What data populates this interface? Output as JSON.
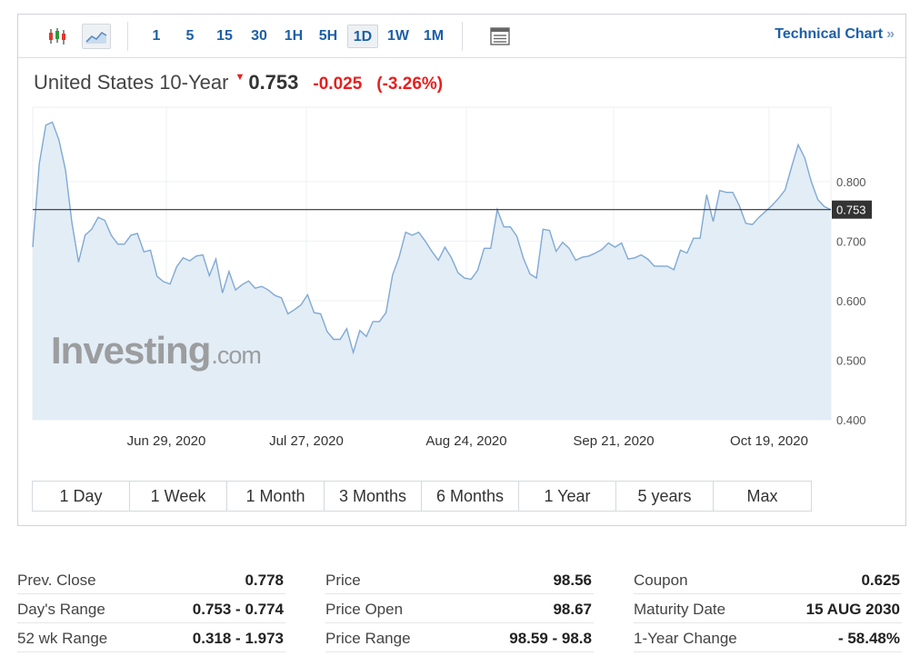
{
  "toolbar": {
    "timeframes": [
      "1",
      "5",
      "15",
      "30",
      "1H",
      "5H",
      "1D",
      "1W",
      "1M"
    ],
    "selected_timeframe": "1D",
    "technical_chart_label": "Technical Chart",
    "technical_chart_chevron": "»",
    "icons": [
      "candlestick-icon",
      "area-chart-icon",
      "table-view-icon"
    ]
  },
  "instrument": {
    "name": "United States 10-Year",
    "direction_arrow": "▼",
    "last": "0.753",
    "change": "-0.025",
    "change_pct": "(-3.26%)",
    "down_color": "#e81f1f"
  },
  "watermark": {
    "brand": "Investing",
    "suffix": ".com"
  },
  "chart_data": {
    "type": "area",
    "series": [
      {
        "values": [
          0.69,
          0.83,
          0.895,
          0.9,
          0.87,
          0.82,
          0.73,
          0.665,
          0.71,
          0.72,
          0.74,
          0.735,
          0.71,
          0.695,
          0.695,
          0.71,
          0.713,
          0.682,
          0.685,
          0.641,
          0.632,
          0.628,
          0.657,
          0.672,
          0.667,
          0.675,
          0.677,
          0.642,
          0.67,
          0.613,
          0.649,
          0.618,
          0.627,
          0.633,
          0.621,
          0.624,
          0.618,
          0.609,
          0.605,
          0.578,
          0.585,
          0.593,
          0.61,
          0.58,
          0.578,
          0.548,
          0.535,
          0.535,
          0.553,
          0.513,
          0.55,
          0.54,
          0.565,
          0.565,
          0.58,
          0.643,
          0.673,
          0.715,
          0.71,
          0.715,
          0.7,
          0.683,
          0.668,
          0.69,
          0.672,
          0.647,
          0.638,
          0.636,
          0.651,
          0.688,
          0.688,
          0.753,
          0.724,
          0.724,
          0.708,
          0.671,
          0.645,
          0.638,
          0.72,
          0.718,
          0.683,
          0.698,
          0.688,
          0.668,
          0.673,
          0.675,
          0.68,
          0.686,
          0.697,
          0.69,
          0.697,
          0.67,
          0.672,
          0.677,
          0.67,
          0.658,
          0.658,
          0.658,
          0.652,
          0.685,
          0.68,
          0.705,
          0.705,
          0.778,
          0.733,
          0.785,
          0.782,
          0.782,
          0.76,
          0.73,
          0.728,
          0.74,
          0.75,
          0.76,
          0.772,
          0.786,
          0.825,
          0.862,
          0.84,
          0.8,
          0.77,
          0.758,
          0.753
        ]
      }
    ],
    "x_tick_labels": [
      "Jun 29, 2020",
      "Jul 27, 2020",
      "Aug 24, 2020",
      "Sep 21, 2020",
      "Oct 19, 2020"
    ],
    "y_tick_labels": [
      "0.400",
      "0.500",
      "0.600",
      "0.700",
      "0.800"
    ],
    "y_ticks": [
      0.4,
      0.5,
      0.6,
      0.7,
      0.8
    ],
    "ylim": [
      0.4,
      0.925
    ],
    "reference_line": 0.753,
    "current_label": "0.753",
    "line_color": "#7fa9d4",
    "fill_color": "#e3edf6",
    "grid": true,
    "xlabel": "",
    "ylabel": ""
  },
  "ranges": [
    "1 Day",
    "1 Week",
    "1 Month",
    "3 Months",
    "6 Months",
    "1 Year",
    "5 years",
    "Max"
  ],
  "stats": [
    [
      {
        "label": "Prev. Close",
        "value": "0.778"
      },
      {
        "label": "Day's Range",
        "value": "0.753 - 0.774"
      },
      {
        "label": "52 wk Range",
        "value": "0.318 - 1.973"
      }
    ],
    [
      {
        "label": "Price",
        "value": "98.56"
      },
      {
        "label": "Price Open",
        "value": "98.67"
      },
      {
        "label": "Price Range",
        "value": "98.59 - 98.8"
      }
    ],
    [
      {
        "label": "Coupon",
        "value": "0.625"
      },
      {
        "label": "Maturity Date",
        "value": "15 AUG 2030"
      },
      {
        "label": "1-Year Change",
        "value": "- 58.48%"
      }
    ]
  ]
}
